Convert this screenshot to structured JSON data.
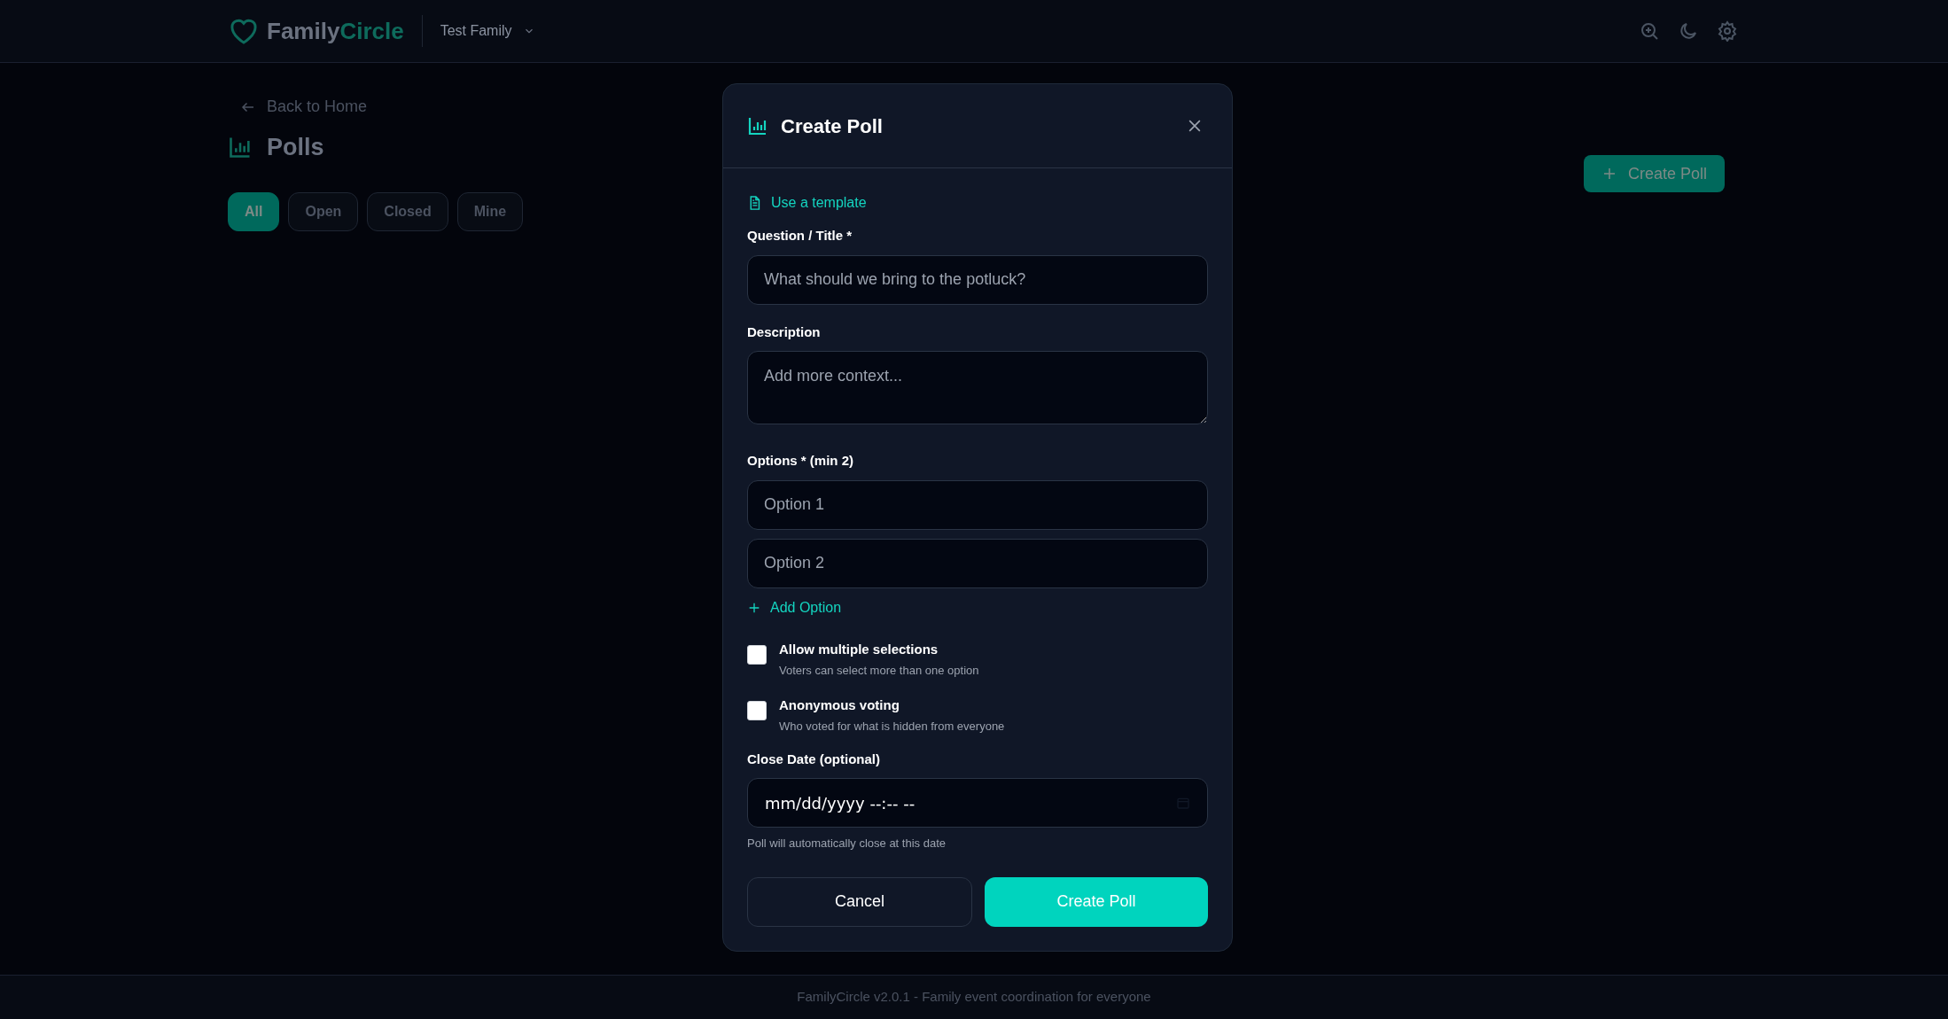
{
  "header": {
    "brand_first": "Family",
    "brand_second": "Circle",
    "family_selector": "Test Family"
  },
  "page": {
    "back_link": "Back to Home",
    "title": "Polls",
    "create_button": "Create Poll",
    "filters": [
      {
        "label": "All",
        "selected": true
      },
      {
        "label": "Open",
        "selected": false
      },
      {
        "label": "Closed",
        "selected": false
      },
      {
        "label": "Mine",
        "selected": false
      }
    ]
  },
  "modal": {
    "title": "Create Poll",
    "template_link": "Use a template",
    "question_label": "Question / Title *",
    "question_placeholder": "What should we bring to the potluck?",
    "description_label": "Description",
    "description_placeholder": "Add more context...",
    "options_label": "Options * (min 2)",
    "options": [
      {
        "placeholder": "Option 1"
      },
      {
        "placeholder": "Option 2"
      }
    ],
    "add_option": "Add Option",
    "settings": [
      {
        "label": "Allow multiple selections",
        "hint": "Voters can select more than one option",
        "checked": false
      },
      {
        "label": "Anonymous voting",
        "hint": "Who voted for what is hidden from everyone",
        "checked": false
      }
    ],
    "close_date_label": "Close Date (optional)",
    "close_date_value": "mm/dd/yyyy --:-- --",
    "close_date_hint": "Poll will automatically close at this date",
    "cancel_button": "Cancel",
    "submit_button": "Create Poll"
  },
  "footer": "FamilyCircle v2.0.1 - Family event coordination for everyone"
}
